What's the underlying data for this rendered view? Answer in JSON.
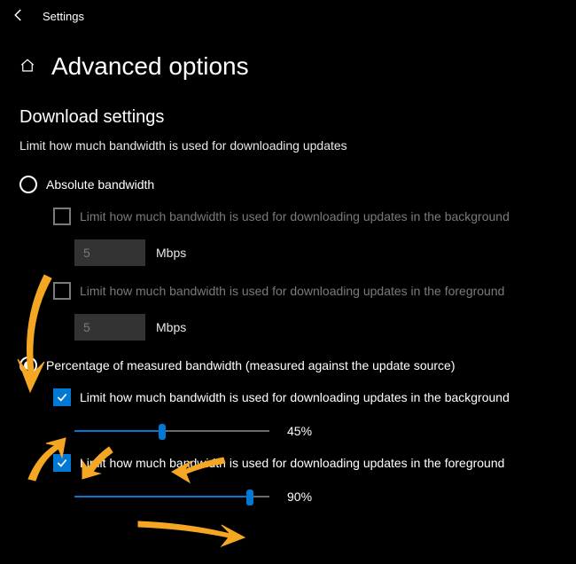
{
  "titlebar": {
    "label": "Settings"
  },
  "header": {
    "title": "Advanced options"
  },
  "section": {
    "title": "Download settings",
    "description": "Limit how much bandwidth is used for downloading updates"
  },
  "absolute": {
    "radio_label": "Absolute bandwidth",
    "bg_check_label": "Limit how much bandwidth is used for downloading updates in the background",
    "bg_value": "5",
    "bg_unit": "Mbps",
    "fg_check_label": "Limit how much bandwidth is used for downloading updates in the foreground",
    "fg_value": "5",
    "fg_unit": "Mbps"
  },
  "percentage": {
    "radio_label": "Percentage of measured bandwidth (measured against the update source)",
    "bg_check_label": "Limit how much bandwidth is used for downloading updates in the background",
    "bg_slider_pct": 45,
    "bg_slider_text": "45%",
    "fg_check_label": "Limit how much bandwidth is used for downloading updates in the foreground",
    "fg_slider_pct": 90,
    "fg_slider_text": "90%"
  }
}
